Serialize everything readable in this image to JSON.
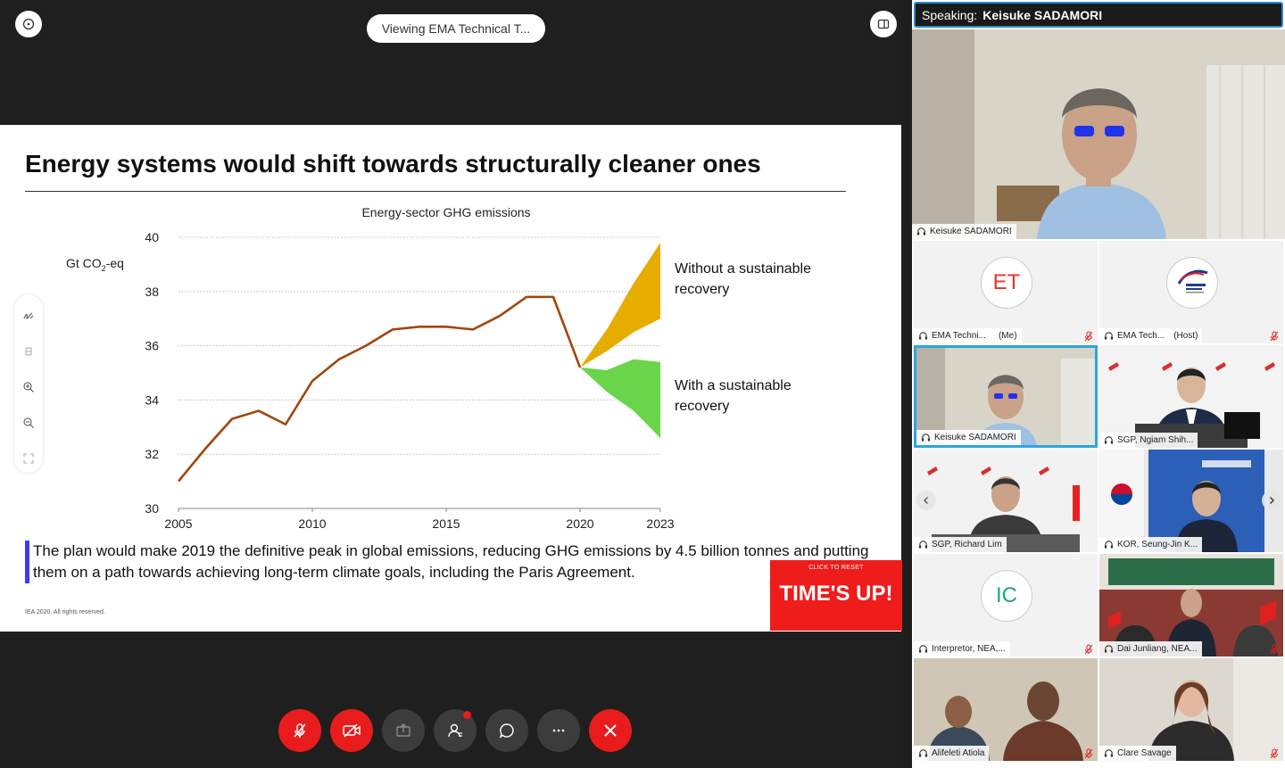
{
  "viewing": {
    "label": "Viewing EMA Technical T..."
  },
  "slide": {
    "title": "Energy systems would shift towards structurally cleaner ones",
    "caption": "The plan would make 2019 the definitive peak in global emissions, reducing GHG emissions by 4.5 billion tonnes and putting them on a path towards achieving long-term climate goals, including the Paris Agreement.",
    "copyright": "IEA 2020. All rights reserved."
  },
  "chart_data": {
    "type": "line",
    "title": "Energy-sector GHG emissions",
    "ylabel_main": "Gt CO",
    "ylabel_sub": "2",
    "ylabel_tail": "-eq",
    "ylim": [
      30,
      40
    ],
    "yticks": [
      30,
      32,
      34,
      36,
      38,
      40
    ],
    "xlim": [
      2005,
      2023
    ],
    "xticks": [
      2005,
      2010,
      2015,
      2020,
      2023
    ],
    "series": [
      {
        "x": [
          2005,
          2006,
          2007,
          2008,
          2009,
          2010,
          2011,
          2012,
          2013,
          2014,
          2015,
          2016,
          2017,
          2018,
          2019,
          2020
        ],
        "values": [
          31.0,
          32.2,
          33.3,
          33.6,
          33.1,
          34.7,
          35.5,
          36.0,
          36.6,
          36.7,
          36.7,
          36.6,
          37.1,
          37.8,
          37.8,
          35.2
        ]
      }
    ],
    "bands": [
      {
        "name": "Without a sustainable recovery",
        "label_lines": [
          "Without a sustainable",
          "recovery"
        ],
        "color": "#e7ac00",
        "x": [
          2020,
          2021,
          2022,
          2023
        ],
        "upper": [
          35.2,
          36.6,
          38.3,
          39.8
        ],
        "lower": [
          35.2,
          35.8,
          36.5,
          37.0
        ]
      },
      {
        "name": "With a sustainable recovery",
        "label_lines": [
          "With a sustainable",
          "recovery"
        ],
        "color": "#6ad44a",
        "x": [
          2020,
          2021,
          2022,
          2023
        ],
        "upper": [
          35.2,
          35.1,
          35.5,
          35.4
        ],
        "lower": [
          35.2,
          34.3,
          33.6,
          32.6
        ]
      }
    ],
    "line_color": "#a0460b"
  },
  "timer": {
    "click_label": "CLICK TO RESET",
    "label": "TIME'S UP!"
  },
  "speaking": {
    "prefix": "Speaking:",
    "name": "Keisuke SADAMORI"
  },
  "participants": {
    "main": {
      "name": "Keisuke SADAMORI"
    },
    "tiles": [
      {
        "name": "EMA Techni...",
        "tag": "(Me)",
        "initials": "ET",
        "initials_color": "#e0392b"
      },
      {
        "name": "EMA Tech...",
        "tag": "(Host)"
      },
      {
        "name": "Keisuke SADAMORI",
        "tag": ""
      },
      {
        "name": "SGP, Ngiam Shih...",
        "tag": ""
      },
      {
        "name": "SGP, Richard Lim",
        "tag": ""
      },
      {
        "name": "KOR, Seung-Jin K...",
        "tag": ""
      },
      {
        "name": "Interpretor, NEA,...",
        "tag": "",
        "initials": "IC",
        "initials_color": "#1aa87a"
      },
      {
        "name": "Dai Junliang, NEA...",
        "tag": ""
      },
      {
        "name": "Alifeleti Atiola",
        "tag": ""
      },
      {
        "name": "Clare Savage",
        "tag": ""
      }
    ]
  },
  "icons": [
    "info-icon",
    "layout-icon",
    "draw-icon",
    "eraser-icon",
    "zoom-in-icon",
    "zoom-out-icon",
    "fit-icon",
    "mute-icon",
    "video-off-icon",
    "share-icon",
    "participants-icon",
    "chat-icon",
    "more-icon",
    "close-icon"
  ]
}
